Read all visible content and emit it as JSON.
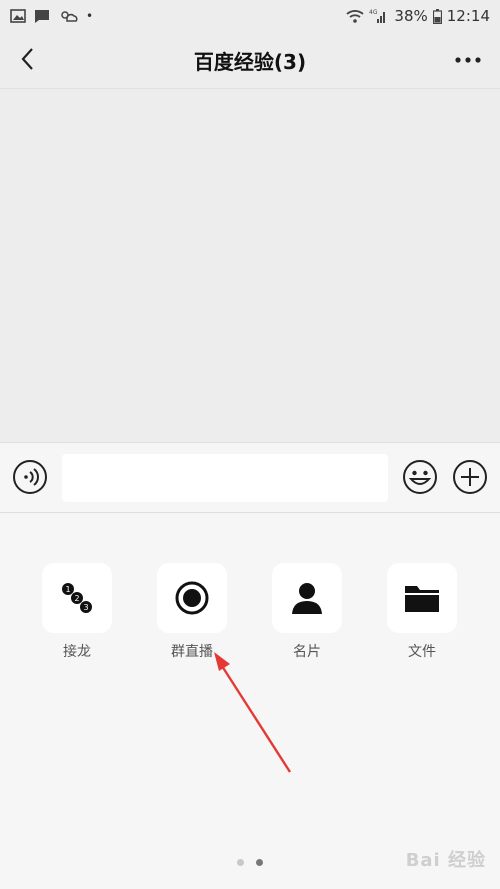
{
  "status_bar": {
    "battery": "38%",
    "time": "12:14",
    "network": "4G",
    "icons": [
      "image-icon",
      "message-icon",
      "weather-icon",
      "wifi-icon",
      "signal-icon",
      "battery-icon"
    ]
  },
  "header": {
    "title": "百度经验(3)",
    "back_icon": "chevron-left-icon",
    "more_icon": "ellipsis-icon"
  },
  "input_bar": {
    "value": "",
    "voice_icon": "voice-icon",
    "emoji_icon": "emoji-icon",
    "plus_icon": "plus-icon"
  },
  "tools": [
    {
      "label": "接龙",
      "icon": "solitaire-icon"
    },
    {
      "label": "群直播",
      "icon": "live-icon"
    },
    {
      "label": "名片",
      "icon": "contact-card-icon"
    },
    {
      "label": "文件",
      "icon": "folder-icon"
    }
  ],
  "pager": {
    "pages": 2,
    "current": 2
  },
  "annotation": {
    "color": "#e53935",
    "points_to": "群直播"
  },
  "watermark": {
    "text": "Bai 经验",
    "url": "jingyan.baidu.com"
  },
  "colors": {
    "background": "#ededed",
    "panel": "#f6f6f6",
    "tile": "#ffffff"
  }
}
